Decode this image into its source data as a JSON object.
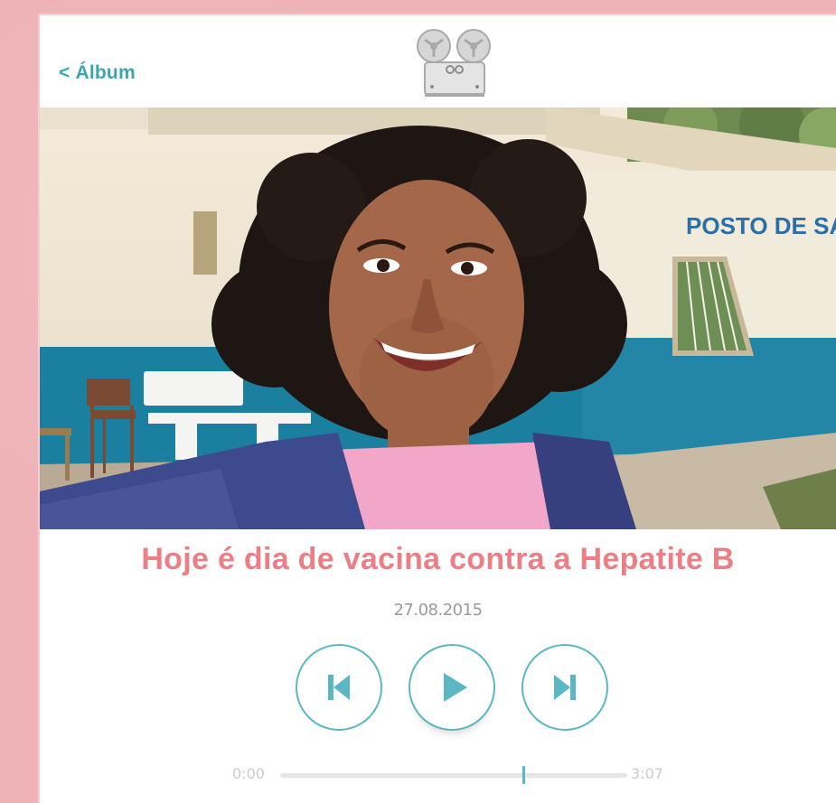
{
  "header": {
    "back_label": "< Álbum",
    "logo_icon": "film-projector-icon"
  },
  "video": {
    "sign_text": "POSTO DE SAÚDE"
  },
  "main": {
    "title": "Hoje é dia de vacina contra a Hepatite B",
    "date": "27.08.2015"
  },
  "player": {
    "prev_icon": "skip-previous-icon",
    "play_icon": "play-icon",
    "next_icon": "skip-next-icon",
    "current_time": "0:00",
    "total_time": "3:07",
    "progress": 0.7
  },
  "colors": {
    "accent": "#5bb8c2",
    "title": "#ec7f86",
    "background": "#efb2b6"
  }
}
